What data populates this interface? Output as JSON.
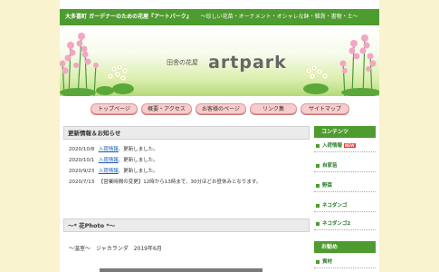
{
  "header": {
    "tagline_bold": "大多喜町 ガーデナーのための花屋『アートパーク』",
    "tagline_rest": "〜珍しい花苗・オーナメント・オシャレな鉢・雑貨・書物・土〜"
  },
  "banner": {
    "subtitle": "田舎の花屋",
    "title": "artpark"
  },
  "nav": {
    "items": [
      "トップページ",
      "概要・アクセス",
      "お客様のページ",
      "リンク集",
      "サイトマップ"
    ]
  },
  "news": {
    "heading": "更新情報＆お知らせ",
    "rows": [
      {
        "date": "2020/10/8",
        "link": "入荷情報",
        "text": "、更新しました。"
      },
      {
        "date": "2020/10/1",
        "link": "入荷情報",
        "text": "、更新しました。"
      },
      {
        "date": "2020/9/23",
        "link": "入荷情報",
        "text": "、更新しました。"
      },
      {
        "date": "2020/7/13",
        "link": "",
        "text": "【営業時間の変更】12時から13時まで、30分ほどお昼休みとなります。"
      }
    ]
  },
  "photo": {
    "heading": "〜* 花Photo *〜",
    "caption": "〜温室〜　ジャカランダ　2019年6月"
  },
  "sidebar": {
    "contents_heading": "コンテンツ",
    "contents_items": [
      "入荷情報",
      "自家苗",
      "野菜",
      "ネコダンゴ",
      "ネコダンゴ2"
    ],
    "new_badge": "NEW",
    "recommend_heading": "お勧め",
    "recommend_items": [
      "資材"
    ]
  },
  "colors": {
    "green": "#4e9b2f",
    "page_bg": "#faf3cf",
    "nav_pink": "#f8cccc",
    "link_blue": "#1a5ab8"
  }
}
